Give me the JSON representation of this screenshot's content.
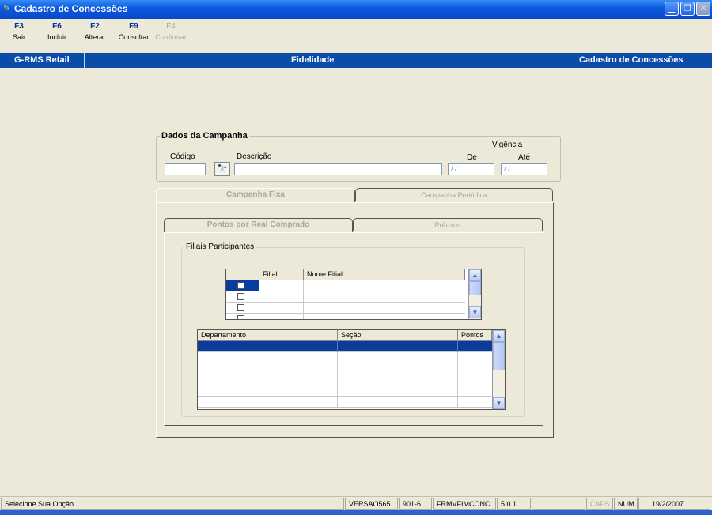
{
  "window": {
    "title": "Cadastro de Concessões"
  },
  "toolbar": [
    {
      "key": "F3",
      "label": "Sair",
      "enabled": true
    },
    {
      "key": "F6",
      "label": "Incluir",
      "enabled": true
    },
    {
      "key": "F2",
      "label": "Alterar",
      "enabled": true
    },
    {
      "key": "F9",
      "label": "Consultar",
      "enabled": true
    },
    {
      "key": "F4",
      "label": "Confirmar",
      "enabled": false
    }
  ],
  "header": {
    "app": "G-RMS Retail",
    "module": "Fidelidade",
    "screen": "Cadastro de Concessões"
  },
  "campaign": {
    "legend": "Dados da Campanha",
    "code_label": "Código",
    "code_value": "",
    "desc_label": "Descrição",
    "desc_value": "",
    "validity_label": "Vigência",
    "from_label": "De",
    "from_value": "/ /",
    "to_label": "Até",
    "to_value": "/ /"
  },
  "outer_tabs": [
    "Campanha Fixa",
    "Campanha Periódica"
  ],
  "inner_tabs": [
    "Pontos por Real Comprado",
    "Prêmios"
  ],
  "branches": {
    "legend": "Filiais Participantes",
    "columns": [
      "",
      "Filial",
      "Nome Filial"
    ]
  },
  "departments": {
    "columns": [
      "Departamento",
      "Seção",
      "Pontos"
    ]
  },
  "statusbar": {
    "message": "Selecione Sua Opção",
    "version": "VERSAO565",
    "code": "901-6",
    "form": "FRMVFIMCONC",
    "build": "5.0.1",
    "caps": "CAPS",
    "num": "NUM",
    "date": "19/2/2007"
  }
}
